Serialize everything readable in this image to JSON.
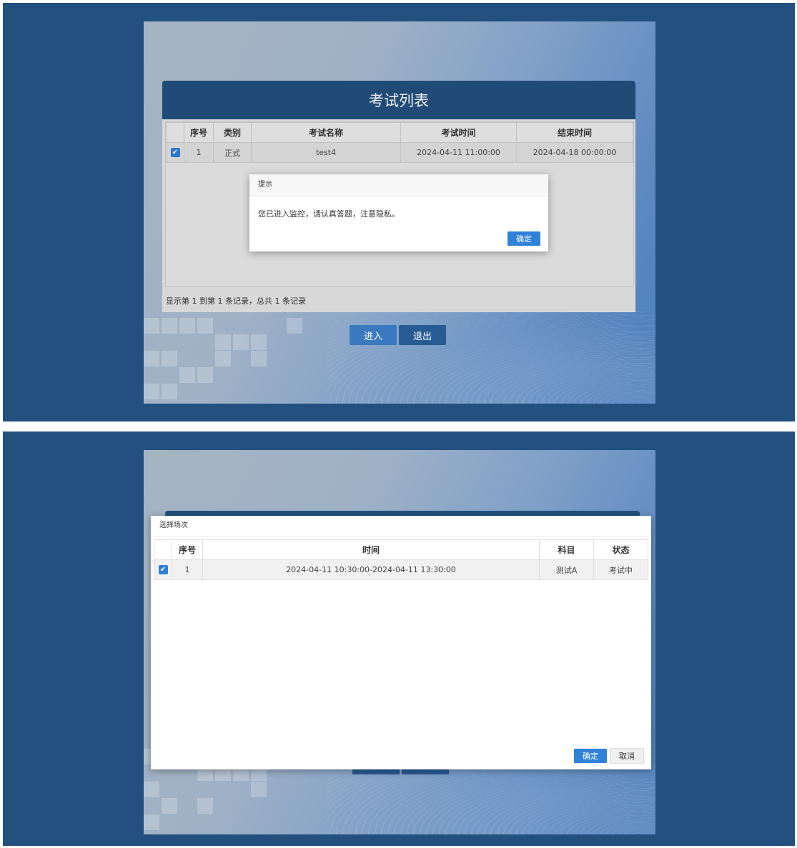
{
  "screen1": {
    "panel_title": "考试列表",
    "columns": [
      "",
      "序号",
      "类别",
      "考试名称",
      "考试时间",
      "结束时间"
    ],
    "rows": [
      {
        "checked": "✔",
        "index": "1",
        "category": "正式",
        "name": "test4",
        "start": "2024-04-11 11:00:00",
        "end": "2024-04-18 00:00:00"
      }
    ],
    "footer": "显示第 1 到第 1 条记录，总共 1 条记录",
    "enter_label": "进入",
    "exit_label": "退出",
    "alert": {
      "title": "提示",
      "message": "您已进入监控，请认真答题，注意隐私。",
      "ok_label": "确定"
    }
  },
  "screen2": {
    "dialog_title": "选择场次",
    "columns": [
      "",
      "序号",
      "时间",
      "科目",
      "状态"
    ],
    "rows": [
      {
        "checked": "✔",
        "index": "1",
        "time": "2024-04-11 10:30:00-2024-04-11 13:30:00",
        "subject": "测试A",
        "status": "考试中"
      }
    ],
    "ok_label": "确定",
    "cancel_label": "取消"
  },
  "colors": {
    "outer_bg": "#23507f",
    "header_bg": "#23507f",
    "primary_button": "#2f82d8",
    "checkbox": "#2f7fd8"
  },
  "icons": {
    "checkbox": "checkbox-checked-icon"
  }
}
